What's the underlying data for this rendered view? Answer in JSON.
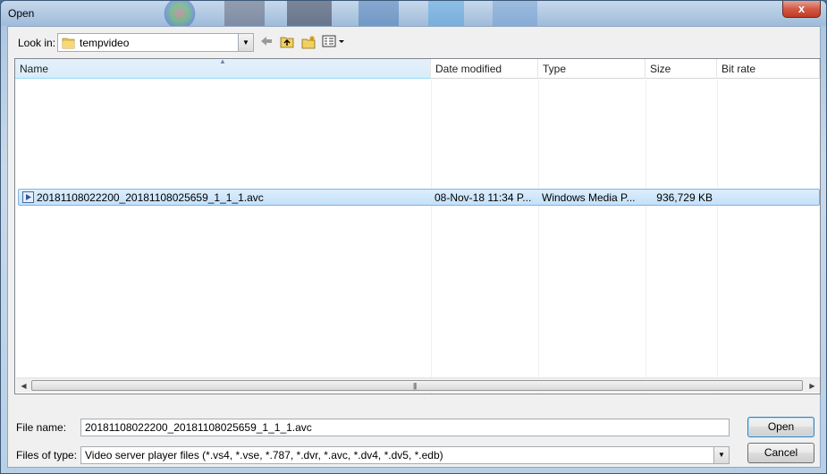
{
  "window": {
    "title": "Open",
    "close_label": "x"
  },
  "toolbar": {
    "look_in_label": "Look in:",
    "look_in_value": "tempvideo",
    "buttons": [
      "back-icon",
      "up-folder-icon",
      "new-folder-icon",
      "view-menu-icon"
    ]
  },
  "list": {
    "columns": [
      "Name",
      "Date modified",
      "Type",
      "Size",
      "Bit rate"
    ],
    "rows": [
      {
        "name": "20181108022200_20181108025659_1_1_1.avc",
        "date": "08-Nov-18 11:34 P...",
        "type": "Windows Media P...",
        "size": "936,729 KB",
        "bitrate": ""
      }
    ]
  },
  "footer": {
    "file_name_label": "File name:",
    "file_name_value": "20181108022200_20181108025659_1_1_1.avc",
    "file_type_label": "Files of type:",
    "file_type_value": "Video server player files (*.vs4, *.vse, *.787, *.dvr, *.avc, *.dv4, *.dv5, *.edb)",
    "open_label": "Open",
    "cancel_label": "Cancel"
  },
  "colors": {
    "selection": "#cce4f8",
    "accent": "#3c7fb1",
    "close": "#c23a22"
  }
}
